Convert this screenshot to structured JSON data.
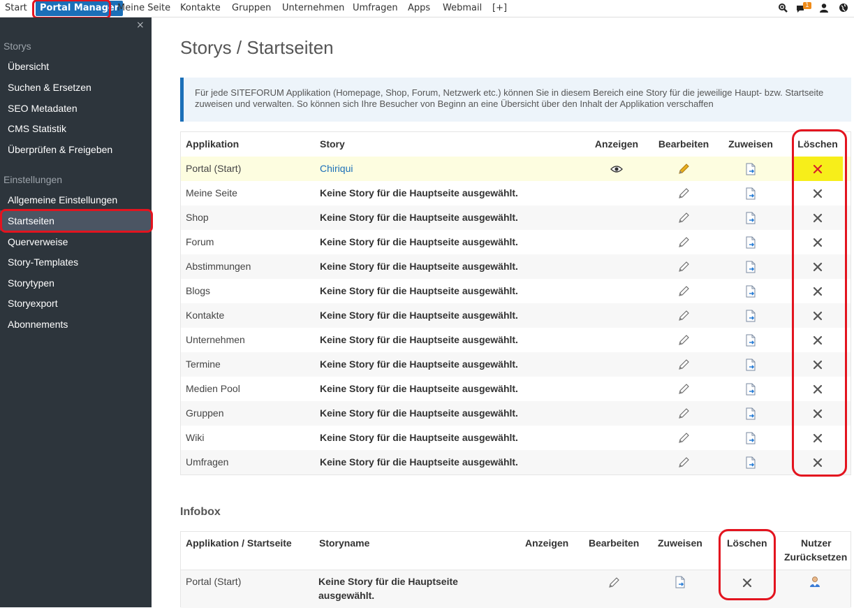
{
  "topnav": {
    "items": [
      "Start",
      "Portal Manager",
      "Meine Seite",
      "Kontakte",
      "Gruppen",
      "Unternehmen",
      "Umfragen",
      "Apps",
      "Webmail",
      "[+]"
    ],
    "notification_count": "1",
    "icons": [
      "zoom-icon",
      "chat-icon",
      "user-icon",
      "globe-icon"
    ]
  },
  "sidebar": {
    "close": "×",
    "group1": "Storys",
    "group1_items": [
      "Übersicht",
      "Suchen & Ersetzen",
      "SEO Metadaten",
      "CMS Statistik",
      "Überprüfen & Freigeben"
    ],
    "group2": "Einstellungen",
    "group2_items": [
      "Allgemeine Einstellungen",
      "Startseiten",
      "Querverweise",
      "Story-Templates",
      "Storytypen",
      "Storyexport",
      "Abonnements"
    ],
    "selected": "Startseiten"
  },
  "main": {
    "title": "Storys / Startseiten",
    "note": "Für jede SITEFORUM Applikation (Homepage, Shop, Forum, Netzwerk etc.) können Sie in diesem Bereich eine Story für die jeweilige Haupt- bzw. Startseite zuweisen und verwalten. So können sich Ihre Besucher von Beginn an eine Übersicht über den Inhalt der Applikation verschaffen",
    "table": {
      "headers": [
        "Applikation",
        "Story",
        "Anzeigen",
        "Bearbeiten",
        "Zuweisen",
        "Löschen"
      ],
      "rows": [
        {
          "app": "Portal (Start)",
          "story": "Chiriqui"
        },
        {
          "app": "Meine Seite",
          "story": "Keine Story für die Hauptseite ausgewählt."
        },
        {
          "app": "Shop",
          "story": "Keine Story für die Hauptseite ausgewählt."
        },
        {
          "app": "Forum",
          "story": "Keine Story für die Hauptseite ausgewählt."
        },
        {
          "app": "Abstimmungen",
          "story": "Keine Story für die Hauptseite ausgewählt."
        },
        {
          "app": "Blogs",
          "story": "Keine Story für die Hauptseite ausgewählt."
        },
        {
          "app": "Kontakte",
          "story": "Keine Story für die Hauptseite ausgewählt."
        },
        {
          "app": "Unternehmen",
          "story": "Keine Story für die Hauptseite ausgewählt."
        },
        {
          "app": "Termine",
          "story": "Keine Story für die Hauptseite ausgewählt."
        },
        {
          "app": "Medien Pool",
          "story": "Keine Story für die Hauptseite ausgewählt."
        },
        {
          "app": "Gruppen",
          "story": "Keine Story für die Hauptseite ausgewählt."
        },
        {
          "app": "Wiki",
          "story": "Keine Story für die Hauptseite ausgewählt."
        },
        {
          "app": "Umfragen",
          "story": "Keine Story für die Hauptseite ausgewählt."
        }
      ]
    },
    "infobox": {
      "title": "Infobox",
      "headers": [
        "Applikation / Startseite",
        "Storyname",
        "Anzeigen",
        "Bearbeiten",
        "Zuweisen",
        "Löschen",
        "Nutzer",
        "Zurücksetzen"
      ],
      "row": {
        "app": "Portal (Start)",
        "story_line1": "Keine Story für die Hauptseite",
        "story_line2": "ausgewählt."
      }
    }
  },
  "colors": {
    "accent": "#1b6fb8",
    "annotation": "#e3141f",
    "sidebar_bg": "#2d353c",
    "highlight": "#f7ee1a"
  }
}
